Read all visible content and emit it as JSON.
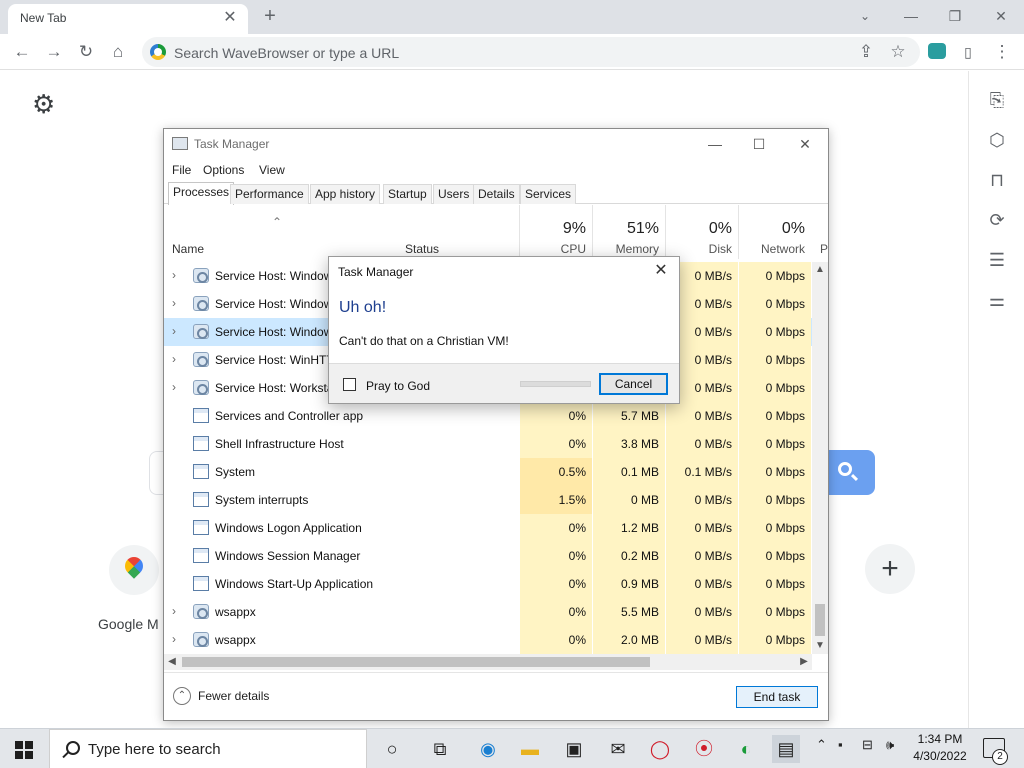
{
  "browser": {
    "tab_title": "New Tab",
    "address_placeholder": "Search WaveBrowser or type a URL"
  },
  "newtab": {
    "shortcut_label": "Google M"
  },
  "taskmanager": {
    "title": "Task Manager",
    "menu": [
      "File",
      "Options",
      "View"
    ],
    "tabs": [
      "Processes",
      "Performance",
      "App history",
      "Startup",
      "Users",
      "Details",
      "Services"
    ],
    "columns": {
      "name": "Name",
      "status": "Status",
      "cpu": {
        "pct": "9%",
        "label": "CPU"
      },
      "memory": {
        "pct": "51%",
        "label": "Memory"
      },
      "disk": {
        "pct": "0%",
        "label": "Disk"
      },
      "network": {
        "pct": "0%",
        "label": "Network"
      },
      "next": "P"
    },
    "processes": [
      {
        "name": "Service Host: Window",
        "cpu": "",
        "memory": "",
        "disk": "0 MB/s",
        "network": "0 Mbps"
      },
      {
        "name": "Service Host: Window",
        "cpu": "",
        "memory": "",
        "disk": "0 MB/s",
        "network": "0 Mbps"
      },
      {
        "name": "Service Host: Window",
        "cpu": "",
        "memory": "",
        "disk": "0 MB/s",
        "network": "0 Mbps"
      },
      {
        "name": "Service Host: WinHTT",
        "cpu": "",
        "memory": "",
        "disk": "0 MB/s",
        "network": "0 Mbps"
      },
      {
        "name": "Service Host: Worksta",
        "cpu": "",
        "memory": "",
        "disk": "0 MB/s",
        "network": "0 Mbps"
      },
      {
        "name": "Services and Controller app",
        "cpu": "0%",
        "memory": "5.7 MB",
        "disk": "0 MB/s",
        "network": "0 Mbps"
      },
      {
        "name": "Shell Infrastructure Host",
        "cpu": "0%",
        "memory": "3.8 MB",
        "disk": "0 MB/s",
        "network": "0 Mbps"
      },
      {
        "name": "System",
        "cpu": "0.5%",
        "memory": "0.1 MB",
        "disk": "0.1 MB/s",
        "network": "0 Mbps"
      },
      {
        "name": "System interrupts",
        "cpu": "1.5%",
        "memory": "0 MB",
        "disk": "0 MB/s",
        "network": "0 Mbps"
      },
      {
        "name": "Windows Logon Application",
        "cpu": "0%",
        "memory": "1.2 MB",
        "disk": "0 MB/s",
        "network": "0 Mbps"
      },
      {
        "name": "Windows Session Manager",
        "cpu": "0%",
        "memory": "0.2 MB",
        "disk": "0 MB/s",
        "network": "0 Mbps"
      },
      {
        "name": "Windows Start-Up Application",
        "cpu": "0%",
        "memory": "0.9 MB",
        "disk": "0 MB/s",
        "network": "0 Mbps"
      },
      {
        "name": "wsappx",
        "cpu": "0%",
        "memory": "5.5 MB",
        "disk": "0 MB/s",
        "network": "0 Mbps"
      },
      {
        "name": "wsappx",
        "cpu": "0%",
        "memory": "2.0 MB",
        "disk": "0 MB/s",
        "network": "0 Mbps"
      }
    ],
    "fewer_details": "Fewer details",
    "end_task": "End task"
  },
  "dialog": {
    "title": "Task Manager",
    "heading": "Uh oh!",
    "message": "Can't do that on a Christian VM!",
    "checkbox_label": "Pray to God",
    "cancel": "Cancel"
  },
  "taskbar": {
    "search_placeholder": "Type here to search",
    "time": "1:34 PM",
    "date": "4/30/2022",
    "notification_count": "2"
  }
}
